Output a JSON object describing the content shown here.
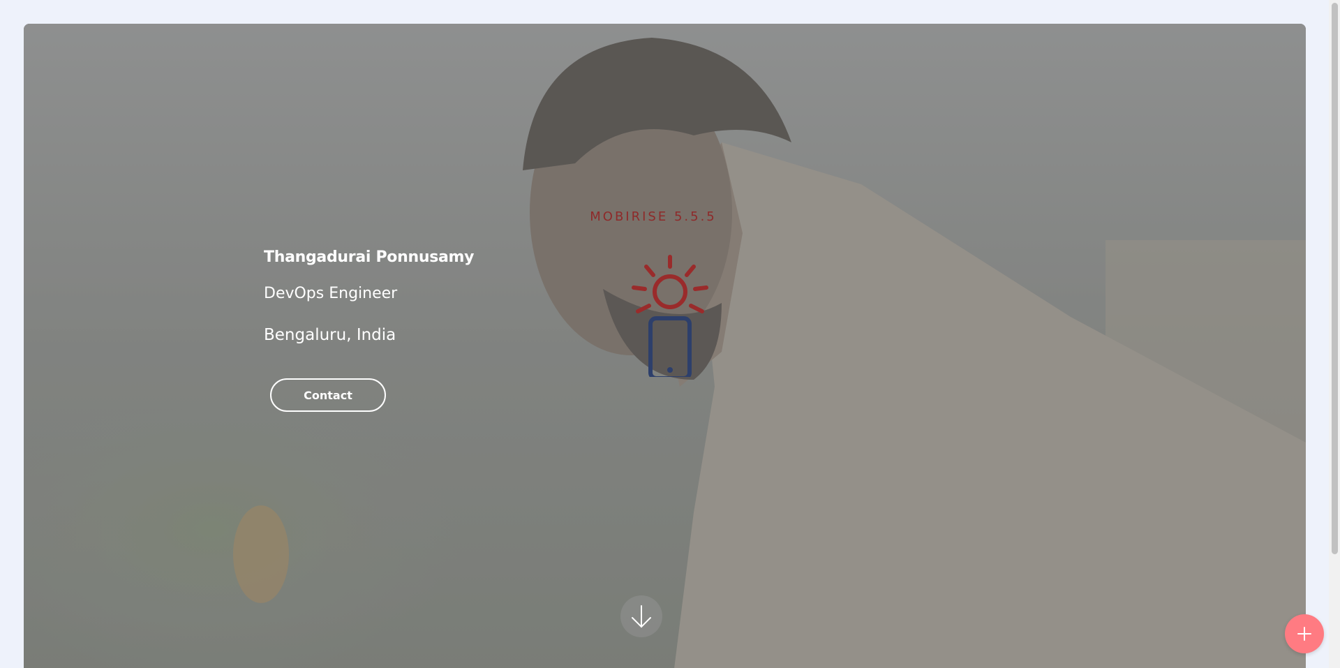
{
  "hero": {
    "name": "Thangadurai Ponnusamy",
    "role": "DevOps Engineer",
    "location": "Bengaluru, India",
    "contact_label": "Contact",
    "background_image": "man-in-profile-photo"
  },
  "badge": {
    "text": "MOBIRISE  5.5.5",
    "icon": "sun-phone-icon"
  },
  "controls": {
    "scroll_down_icon": "arrow-down-icon",
    "fab_icon": "plus-icon"
  },
  "colors": {
    "page_bg": "#eef2fb",
    "fab": "#ff7b82",
    "badge_text": "#8e2a2a",
    "badge_phone": "#2d3f6b"
  }
}
